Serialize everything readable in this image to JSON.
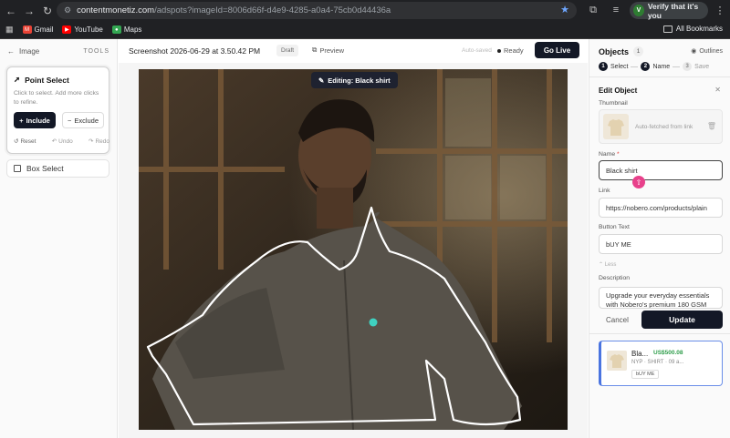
{
  "browser": {
    "url_host": "contentmonetiz.com",
    "url_rest": "/adspots?imageId=8006d66f-d4e9-4285-a0a4-75cb0d44436a",
    "verify_label": "Verify that it's you",
    "bookmarks": [
      "Gmail",
      "YouTube",
      "Maps"
    ],
    "all_bookmarks": "All Bookmarks"
  },
  "left_panel": {
    "back_label": "Image",
    "tools_label": "TOOLS",
    "point_select": {
      "title": "Point Select",
      "description": "Click to select. Add more clicks to refine.",
      "include_label": "Include",
      "exclude_label": "Exclude",
      "reset_label": "Reset",
      "undo_label": "Undo",
      "redo_label": "Redo"
    },
    "box_select_label": "Box Select"
  },
  "toolbar": {
    "title": "Screenshot 2026-06-29 at 3.50.42 PM",
    "status_badge": "Draft",
    "preview_label": "Preview",
    "autosaved_label": "Auto-saved",
    "ready_label": "Ready",
    "golive_label": "Go Live"
  },
  "canvas": {
    "editing_label": "Editing: Black shirt"
  },
  "right_panel": {
    "objects_label": "Objects",
    "objects_count": "1",
    "outlines_label": "Outlines",
    "steps": [
      {
        "num": "1",
        "label": "Select"
      },
      {
        "num": "2",
        "label": "Name"
      },
      {
        "num": "3",
        "label": "Save"
      }
    ],
    "edit_title": "Edit Object",
    "thumbnail_label": "Thumbnail",
    "thumbnail_hint": "Auto-fetched from link",
    "name_label": "Name",
    "name_value": "Black shirt",
    "link_label": "Link",
    "link_value": "https://nobero.com/products/plain",
    "button_text_label": "Button Text",
    "button_text_value": "bUY ME",
    "less_label": "Less",
    "description_label": "Description",
    "description_value": "Upgrade your everyday essentials with Nobero's premium 180 GSM",
    "cancel_label": "Cancel",
    "update_label": "Update",
    "object_card": {
      "name": "Bla...",
      "price": "US$500.08",
      "meta": "NYP · SHIRT · 09 a...",
      "button": "bUY ME"
    }
  },
  "colors": {
    "primary": "#131826",
    "accent_blue": "#4a74e0",
    "price_green": "#2e9d4a",
    "cursor_pink": "#e8418b",
    "marker_teal": "#3fd1c0"
  }
}
